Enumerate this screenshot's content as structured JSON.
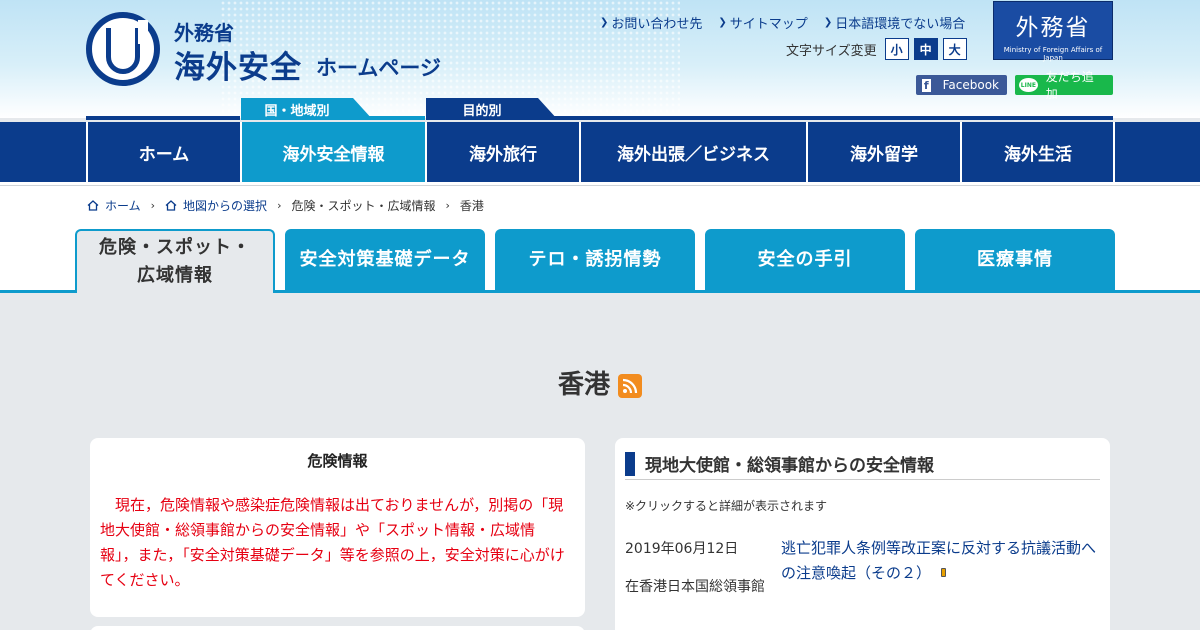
{
  "header": {
    "ministry": "外務省",
    "title": "海外安全",
    "subtitle": "ホームページ",
    "links": [
      "お問い合わせ先",
      "サイトマップ",
      "日本語環境でない場合"
    ],
    "fontsize_label": "文字サイズ変更",
    "fontsize_options": [
      "小",
      "中",
      "大"
    ],
    "fontsize_selected": "中",
    "mofa_kanji": "外務省",
    "mofa_en": "Ministry of Foreign Affairs of Japan",
    "facebook_label": "Facebook",
    "line_icon": "LINE",
    "line_label": "友だち追加"
  },
  "nav": {
    "tag_country": "国・地域別",
    "tag_purpose": "目的別",
    "items": [
      "ホーム",
      "海外安全情報",
      "海外旅行",
      "海外出張／ビジネス",
      "海外留学",
      "海外生活"
    ],
    "active": "海外安全情報"
  },
  "breadcrumb": [
    "ホーム",
    "地図からの選択",
    "危険・スポット・広域情報",
    "香港"
  ],
  "subtabs": {
    "active_line1": "危険・スポット・",
    "active_line2": "広域情報",
    "items": [
      "安全対策基礎データ",
      "テロ・誘拐情勢",
      "安全の手引",
      "医療事情"
    ]
  },
  "page": {
    "title": "香港"
  },
  "danger_card": {
    "heading": "危険情報",
    "body": "現在，危険情報や感染症危険情報は出ておりませんが，別掲の「現地大使館・総領事館からの安全情報」や「スポット情報・広域情報」，また，「安全対策基礎データ」等を参照の上，安全対策に心がけてください。"
  },
  "embassy_card": {
    "heading": "現地大使館・総領事館からの安全情報",
    "note": "※クリックすると詳細が表示されます",
    "entries": [
      {
        "date": "2019年06月12日",
        "source": "在香港日本国総領事館",
        "title": "逃亡犯罪人条例等改正案に反対する抗議活動への注意喚起（その２）"
      }
    ]
  },
  "colors": {
    "navy": "#0b3c8c",
    "cyan": "#0e9bcc",
    "alert_red": "#e60012",
    "page_bg": "#e6e9ec"
  }
}
